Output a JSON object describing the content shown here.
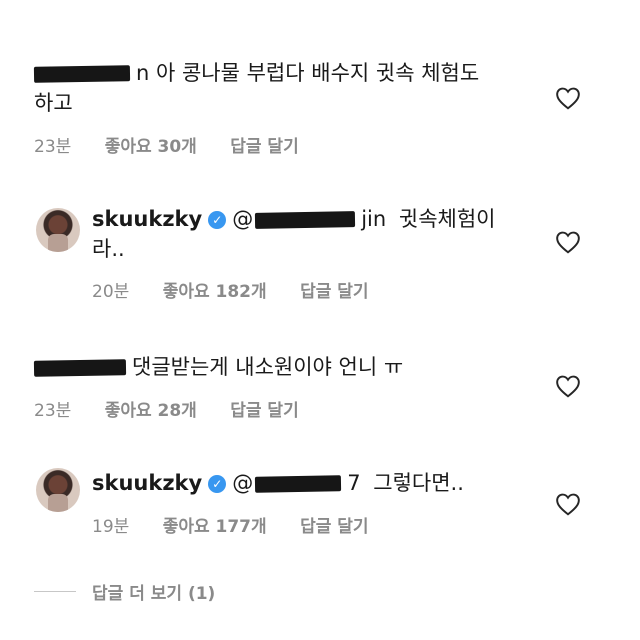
{
  "comments": [
    {
      "text_suffix": "n 아 콩나물 부럽다 배수지 귓속 체험도",
      "text_line2": "하고",
      "time": "23분",
      "likes": "좋아요 30개",
      "reply": "답글 달기"
    },
    {
      "username": "skuukzky",
      "mention_suffix": "jin",
      "text": "귓속체험이",
      "text_line2": "라..",
      "time": "20분",
      "likes": "좋아요 182개",
      "reply": "답글 달기"
    },
    {
      "text": "댓글받는게 내소원이야 언니 ㅠ",
      "time": "23분",
      "likes": "좋아요 28개",
      "reply": "답글 달기"
    },
    {
      "username": "skuukzky",
      "mention_suffix": "7",
      "text": "그렇다면..",
      "time": "19분",
      "likes": "좋아요 177개",
      "reply": "답글 달기"
    }
  ],
  "view_replies": "답글 더 보기 (1)",
  "colors": {
    "verified": "#3897f0",
    "meta": "#8a8a8a",
    "text": "#1a1a1a"
  },
  "icons": {
    "like": "heart-outline-icon",
    "verified": "verified-badge-icon"
  }
}
